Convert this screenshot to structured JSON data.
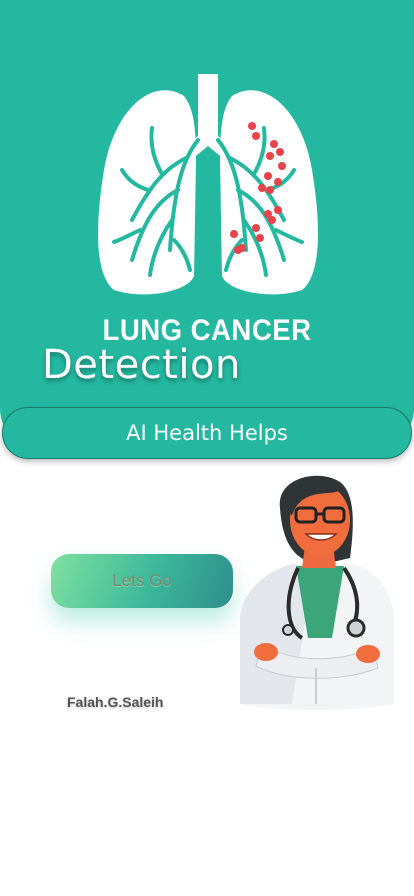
{
  "hero": {
    "logo_text": "LUNG CANCER",
    "title": "Detection",
    "tagline": "AI Health Helps"
  },
  "cta": {
    "label": "Lets Go"
  },
  "footer": {
    "author": "Falah.G.Saleih"
  },
  "colors": {
    "hero_background": "#24b8a0",
    "accent_green": "#6fcf8c",
    "tumor_dot": "#e8424a"
  },
  "icons": {
    "lungs": "lungs-illustration",
    "doctor": "doctor-illustration"
  }
}
